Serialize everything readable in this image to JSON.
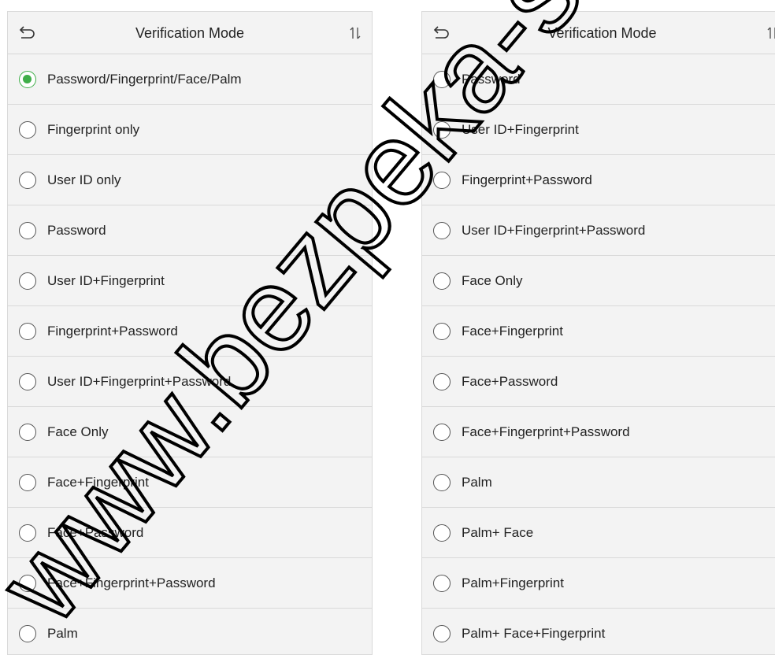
{
  "left_screen": {
    "title": "Verification Mode",
    "selected_index": 0,
    "options": [
      {
        "label": "Password/Fingerprint/Face/Palm"
      },
      {
        "label": "Fingerprint only"
      },
      {
        "label": "User ID only"
      },
      {
        "label": "Password"
      },
      {
        "label": "User ID+Fingerprint"
      },
      {
        "label": "Fingerprint+Password"
      },
      {
        "label": "User ID+Fingerprint+Password"
      },
      {
        "label": "Face Only"
      },
      {
        "label": "Face+Fingerprint"
      },
      {
        "label": "Face+Password"
      },
      {
        "label": "Face+Fingerprint+Password"
      },
      {
        "label": "Palm"
      }
    ]
  },
  "right_screen": {
    "title": "Verification Mode",
    "selected_index": null,
    "options": [
      {
        "label": "Password"
      },
      {
        "label": "User ID+Fingerprint"
      },
      {
        "label": "Fingerprint+Password"
      },
      {
        "label": "User ID+Fingerprint+Password"
      },
      {
        "label": "Face Only"
      },
      {
        "label": "Face+Fingerprint"
      },
      {
        "label": "Face+Password"
      },
      {
        "label": "Face+Fingerprint+Password"
      },
      {
        "label": "Palm"
      },
      {
        "label": "Palm+ Face"
      },
      {
        "label": "Palm+Fingerprint"
      },
      {
        "label": "Palm+ Face+Fingerprint"
      }
    ]
  },
  "icons": {
    "back": "back-arrow-icon",
    "sort": "sort-arrows-icon",
    "radio": "radio-button-icon"
  },
  "colors": {
    "accent": "#3fae49",
    "background": "#f3f3f3",
    "watermark": "#000000"
  },
  "watermark": {
    "text": "www.bezpeka-shop.com"
  }
}
